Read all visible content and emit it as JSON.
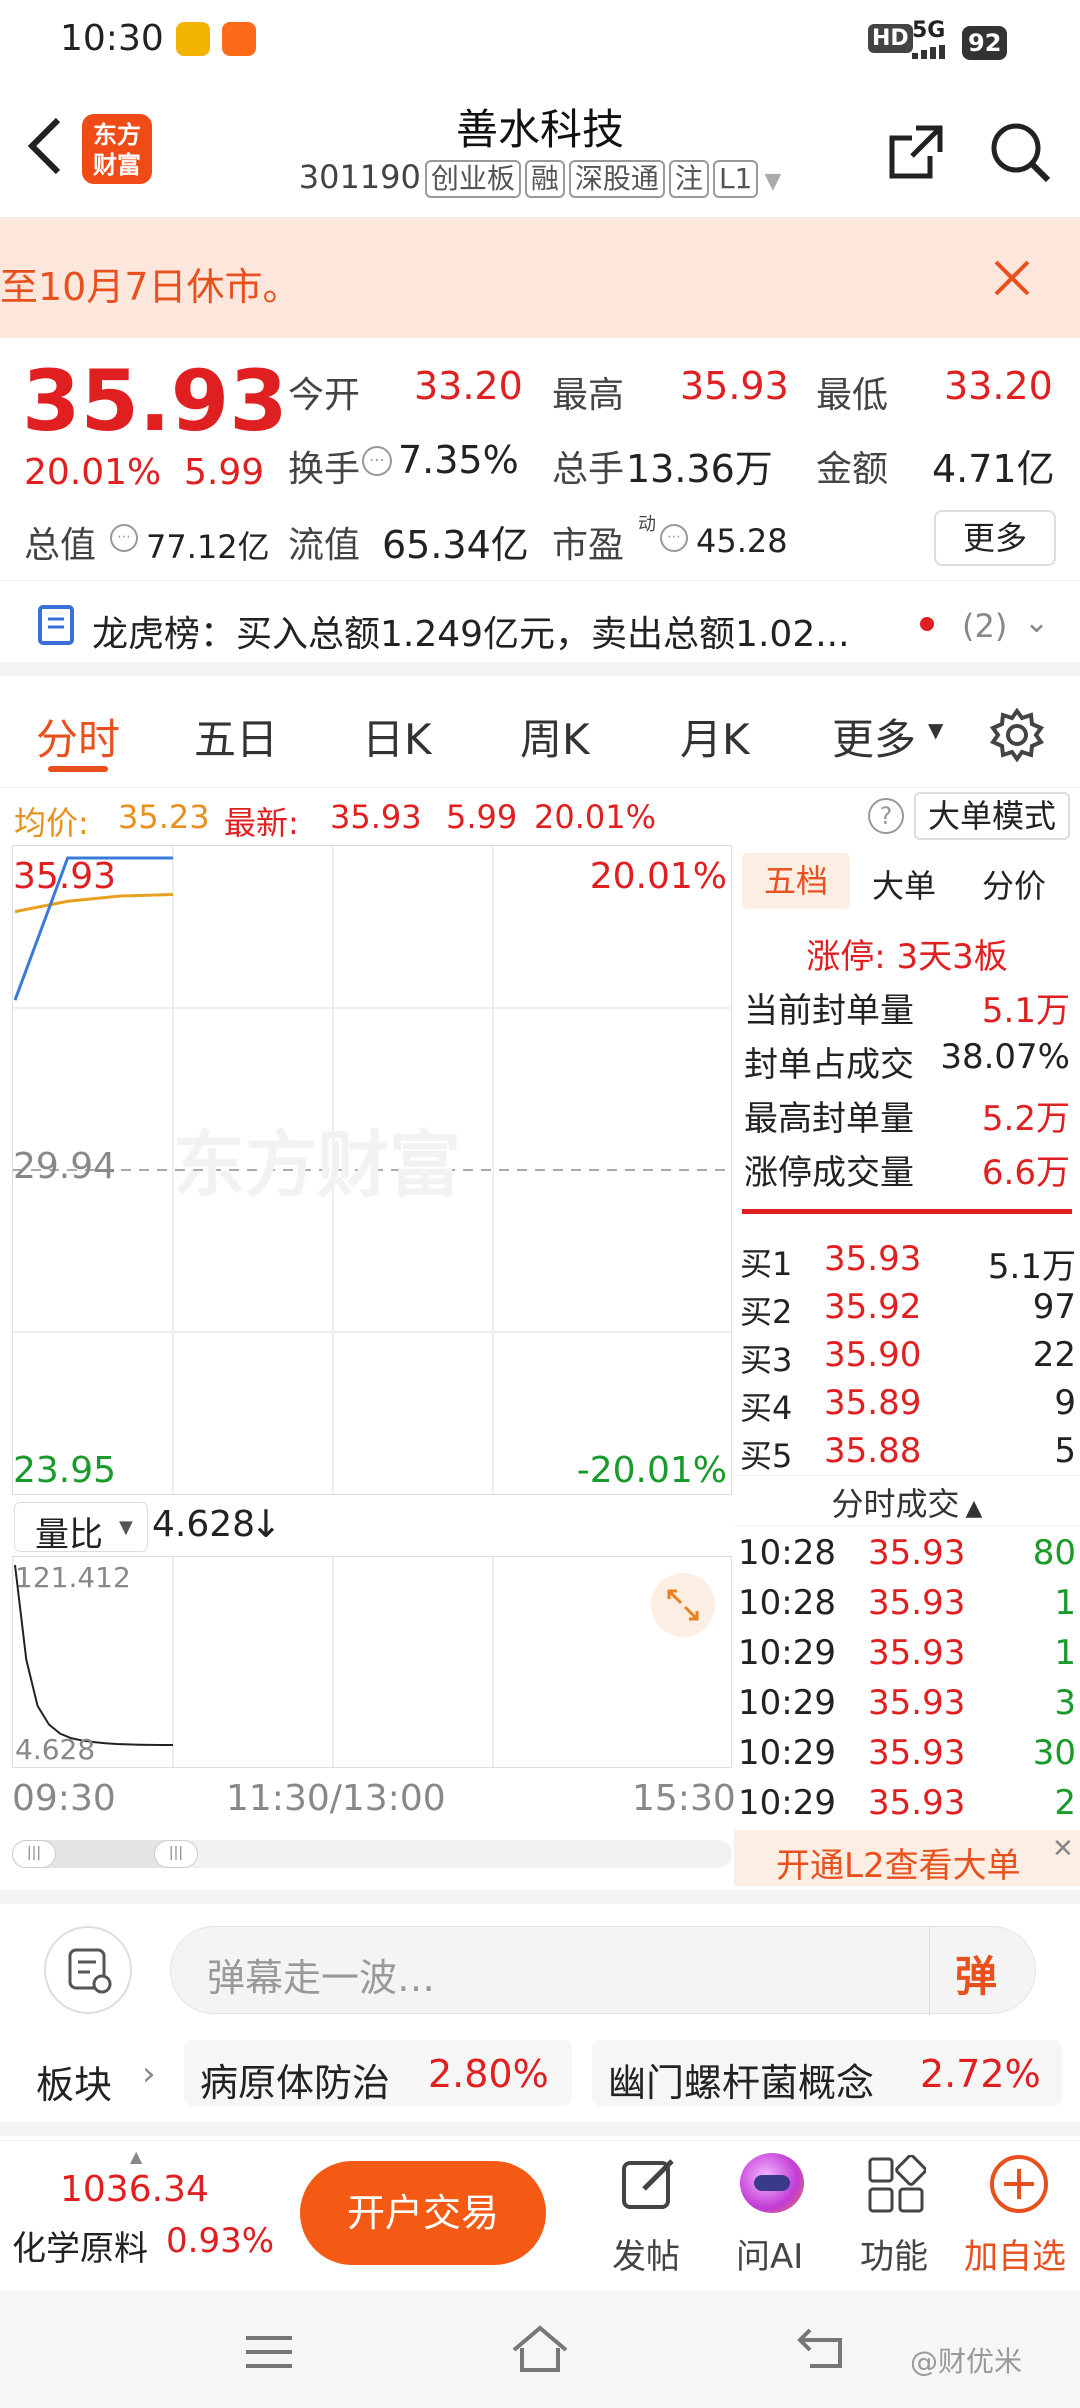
{
  "status_bar": {
    "time": "10:30",
    "hd": "HD",
    "network": "5G",
    "battery": "92"
  },
  "header": {
    "app_logo_text": "东方财富",
    "title": "善水科技",
    "code": "301190",
    "tags": [
      "创业板",
      "融",
      "深股通",
      "注",
      "L1"
    ]
  },
  "notice": {
    "text": "至10月7日休市。"
  },
  "quote": {
    "price": "35.93",
    "change_pct": "20.01%",
    "change_amt": "5.99",
    "open_label": "今开",
    "open": "33.20",
    "high_label": "最高",
    "high": "35.93",
    "low_label": "最低",
    "low": "33.20",
    "turnover_label": "换手",
    "turnover": "7.35%",
    "volume_label": "总手",
    "volume": "13.36万",
    "amount_label": "金额",
    "amount": "4.71亿",
    "mcap_label": "总值",
    "mcap": "77.12亿",
    "float_label": "流值",
    "float": "65.34亿",
    "pe_label": "市盈",
    "pe_sup": "动",
    "pe": "45.28",
    "more_label": "更多"
  },
  "dragon": {
    "text": "龙虎榜：买入总额1.249亿元，卖出总额1.02...",
    "count": "(2)"
  },
  "tabs": [
    "分时",
    "五日",
    "日K",
    "周K",
    "月K",
    "更多"
  ],
  "chart_info": {
    "avg_label": "均价:",
    "avg": "35.23",
    "latest_label": "最新:",
    "latest": "35.93",
    "chg": "5.99",
    "pct": "20.01%",
    "mode_button": "大单模式"
  },
  "chart_data": {
    "type": "line",
    "price_top": "35.93",
    "price_mid": "29.94",
    "price_bottom": "23.95",
    "pct_top": "20.01%",
    "pct_bottom": "-20.01%",
    "watermark": "东方财富",
    "ylim": [
      23.95,
      35.93
    ],
    "price_series": [
      33.2,
      35.93,
      35.93,
      35.93
    ],
    "avg_series": [
      34.9,
      35.1,
      35.2,
      35.23
    ],
    "volume_ratio_label": "量比",
    "volume_ratio": "4.628",
    "volume_ratio_arrow": "↓",
    "vr_top": "121.412",
    "vr_bottom": "4.628",
    "volume_ratio_series": [
      121.412,
      60,
      30,
      18,
      12,
      9,
      7.5,
      6.5,
      5.8,
      5.3,
      5.0,
      4.8,
      4.7,
      4.65,
      4.628
    ],
    "time_labels": [
      "09:30",
      "11:30/13:00",
      "15:30"
    ]
  },
  "order_book": {
    "tabs": [
      "五档",
      "大单",
      "分价"
    ],
    "limit_title": "涨停: 3天3板",
    "stats": [
      {
        "label": "当前封单量",
        "value": "5.1万",
        "color": "red"
      },
      {
        "label": "封单占成交",
        "value": "38.07%",
        "color": "black"
      },
      {
        "label": "最高封单量",
        "value": "5.2万",
        "color": "red"
      },
      {
        "label": "涨停成交量",
        "value": "6.6万",
        "color": "red"
      }
    ],
    "bids": [
      {
        "label": "买1",
        "price": "35.93",
        "vol": "5.1万"
      },
      {
        "label": "买2",
        "price": "35.92",
        "vol": "97"
      },
      {
        "label": "买3",
        "price": "35.90",
        "vol": "22"
      },
      {
        "label": "买4",
        "price": "35.89",
        "vol": "9"
      },
      {
        "label": "买5",
        "price": "35.88",
        "vol": "5"
      }
    ],
    "ticks_title": "分时成交",
    "ticks": [
      {
        "time": "10:28",
        "price": "35.93",
        "vol": "80"
      },
      {
        "time": "10:28",
        "price": "35.93",
        "vol": "1"
      },
      {
        "time": "10:29",
        "price": "35.93",
        "vol": "1"
      },
      {
        "time": "10:29",
        "price": "35.93",
        "vol": "3"
      },
      {
        "time": "10:29",
        "price": "35.93",
        "vol": "30"
      },
      {
        "time": "10:29",
        "price": "35.93",
        "vol": "2"
      }
    ],
    "l2_banner": "开通L2查看大单"
  },
  "danmu": {
    "placeholder": "弹幕走一波…",
    "send_label": "弹"
  },
  "sector": {
    "label": "板块",
    "items": [
      {
        "name": "病原体防治",
        "pct": "2.80%"
      },
      {
        "name": "幽门螺杆菌概念",
        "pct": "2.72%"
      }
    ]
  },
  "bottom": {
    "index_value": "1036.34",
    "index_name": "化学原料",
    "index_pct": "0.93%",
    "trade_button": "开户交易",
    "actions": [
      {
        "label": "发帖",
        "icon": "edit-icon"
      },
      {
        "label": "问AI",
        "icon": "ai-icon"
      },
      {
        "label": "功能",
        "icon": "grid-icon"
      },
      {
        "label": "加自选",
        "icon": "plus-circle-icon"
      }
    ]
  },
  "watermark_corner": "@财优米"
}
